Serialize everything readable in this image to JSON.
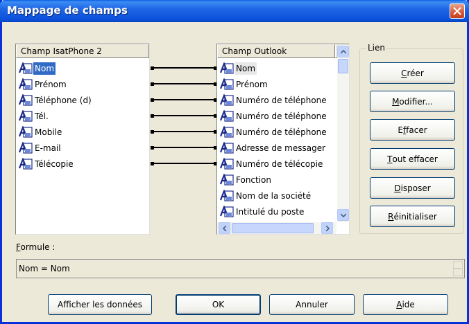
{
  "window": {
    "title": "Mappage de champs",
    "close_icon": "close-x-icon"
  },
  "left_list": {
    "header": "Champ IsatPhone 2",
    "items": [
      "Nom",
      "Prénom",
      "Téléphone (d)",
      "Tél.",
      "Mobile",
      "E-mail",
      "Télécopie"
    ]
  },
  "right_list": {
    "header": "Champ Outlook",
    "items": [
      "Nom",
      "Prénom",
      "Numéro de téléphone",
      "Numéro de téléphone",
      "Numéro de téléphone",
      "Adresse de messager",
      "Numéro de télécopie",
      "Fonction",
      "Nom de la société",
      "Intitulé du poste"
    ]
  },
  "group": {
    "label": "Lien",
    "buttons": {
      "creer": {
        "access_key": "C",
        "rest": "réer"
      },
      "modifier": {
        "access_key": "M",
        "rest": "odifier..."
      },
      "effacer": {
        "pre": "E",
        "access_key": "f",
        "rest": "facer"
      },
      "tout_effacer": {
        "access_key": "T",
        "rest": "out effacer"
      },
      "disposer": {
        "access_key": "D",
        "rest": "isposer"
      },
      "reinitialiser": {
        "access_key": "R",
        "rest": "éinitialiser"
      }
    }
  },
  "formula": {
    "label_key": "F",
    "label_rest": "ormule :",
    "value": "Nom = Nom"
  },
  "footer": {
    "afficher": "Afficher les données",
    "ok": "OK",
    "annuler": "Annuler",
    "aide_key": "A",
    "aide_rest": "ide"
  },
  "colors": {
    "title_bar": "#0B50DA",
    "selection": "#316AC5"
  },
  "field_icon": "field-a-icon"
}
